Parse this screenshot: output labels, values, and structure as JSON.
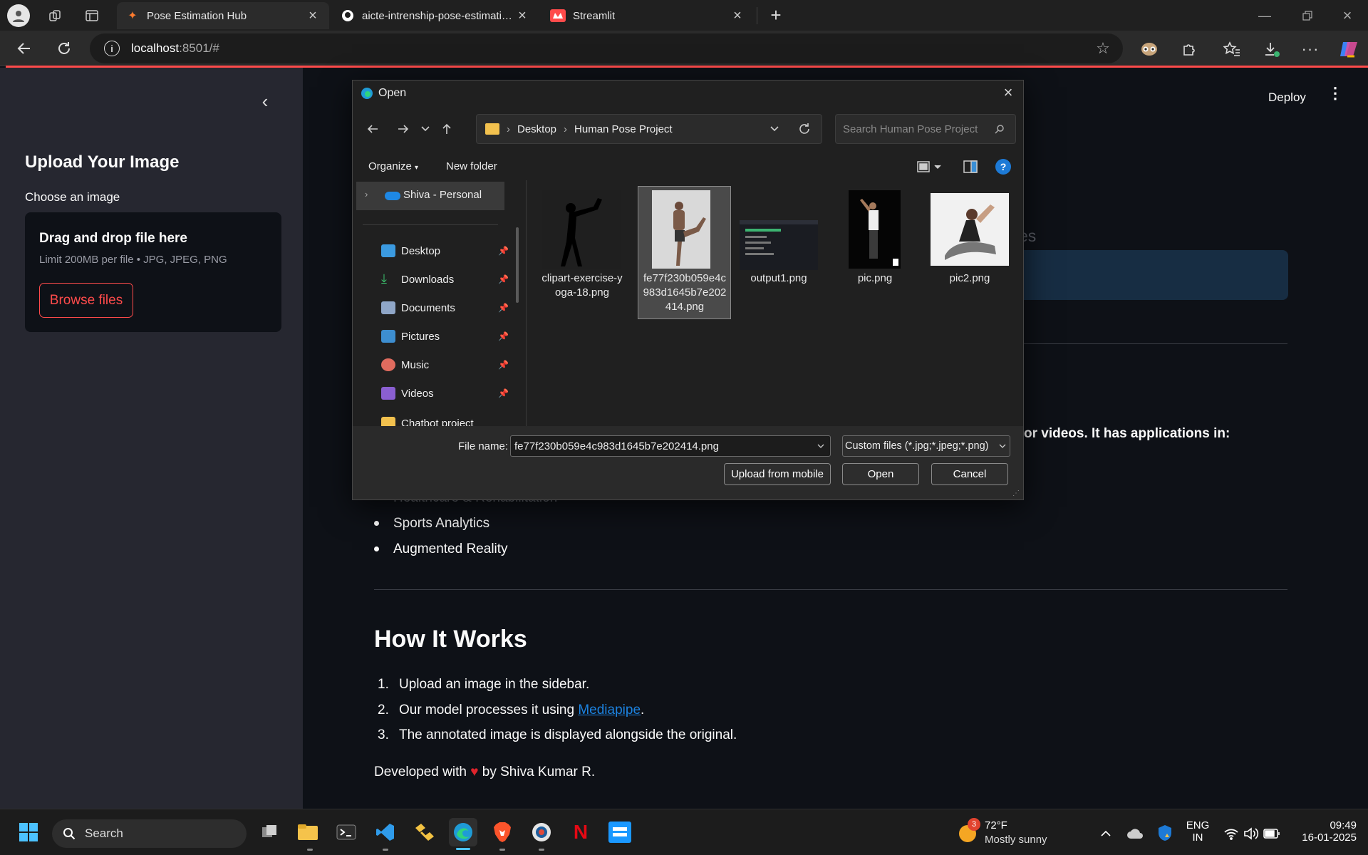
{
  "browser": {
    "tabs": [
      {
        "title": "Pose Estimation Hub",
        "active": true
      },
      {
        "title": "aicte-intrenship-pose-estimation/",
        "active": false
      },
      {
        "title": "Streamlit",
        "active": false
      }
    ],
    "url_host": "localhost",
    "url_rest": ":8501/#"
  },
  "sidebar": {
    "title": "Upload Your Image",
    "uploader_label": "Choose an image",
    "dropzone_title": "Drag and drop file here",
    "dropzone_limit": "Limit 200MB per file • JPG, JPEG, PNG",
    "browse_button": "Browse files"
  },
  "header": {
    "deploy": "Deploy"
  },
  "main": {
    "partial_heading_tail": "es",
    "intro_tail": "or videos. It has applications in:",
    "applications": [
      "Healthcare & Rehabilitation",
      "Sports Analytics",
      "Augmented Reality"
    ],
    "how_title": "How It Works",
    "steps": [
      "Upload an image in the sidebar.",
      "Our model processes it using ",
      "The annotated image is displayed alongside the original."
    ],
    "step2_link": "Mediapipe",
    "step2_after": ".",
    "numbers": [
      "1.",
      "2.",
      "3."
    ],
    "footer_before": "Developed with ",
    "footer_after": " by Shiva Kumar R."
  },
  "dialog": {
    "title": "Open",
    "breadcrumb": [
      "Desktop",
      "Human Pose Project"
    ],
    "search_placeholder": "Search Human Pose Project",
    "organize": "Organize",
    "new_folder": "New folder",
    "nav_root": "Shiva - Personal",
    "nav_items": [
      "Desktop",
      "Downloads",
      "Documents",
      "Pictures",
      "Music",
      "Videos",
      "Chatbot project"
    ],
    "files": [
      {
        "name": "clipart-exercise-yoga-18.png",
        "l1": "clipart-exercise-y",
        "l2": "oga-18.png",
        "l3": ""
      },
      {
        "name": "fe77f230b059e4c983d1645b7e202414.png",
        "l1": "fe77f230b059e4c",
        "l2": "983d1645b7e202",
        "l3": "414.png"
      },
      {
        "name": "output1.png",
        "l1": "output1.png",
        "l2": "",
        "l3": ""
      },
      {
        "name": "pic.png",
        "l1": "pic.png",
        "l2": "",
        "l3": ""
      },
      {
        "name": "pic2.png",
        "l1": "pic2.png",
        "l2": "",
        "l3": ""
      }
    ],
    "file_name_label": "File name:",
    "file_name_value": "fe77f230b059e4c983d1645b7e202414.png",
    "file_type": "Custom files (*.jpg;*.jpeg;*.png)",
    "upload_mobile": "Upload from mobile",
    "open": "Open",
    "cancel": "Cancel"
  },
  "taskbar": {
    "search": "Search",
    "weather_temp": "72°F",
    "weather_desc": "Mostly sunny",
    "weather_badge": "3",
    "lang1": "ENG",
    "lang2": "IN",
    "time": "09:49",
    "date": "16-01-2025"
  },
  "colors": {
    "accent": "#ff4b4b",
    "link": "#1c83e1",
    "sidebar": "#262730",
    "bg": "#0e1117"
  }
}
